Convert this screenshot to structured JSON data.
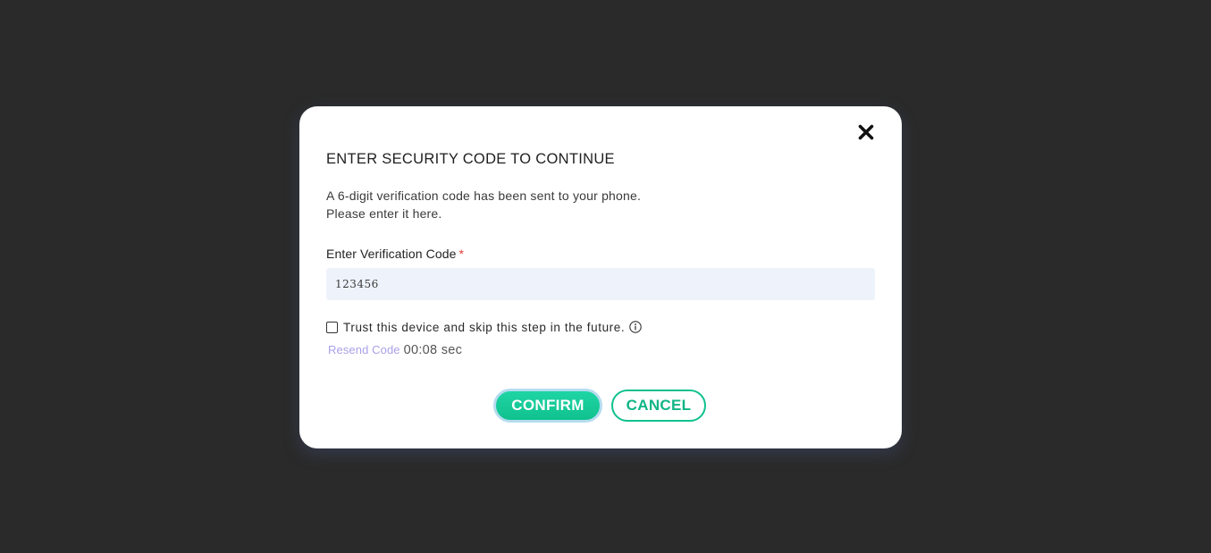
{
  "modal": {
    "title": "ENTER SECURITY CODE TO CONTINUE",
    "description_line1": "A 6-digit verification code has been sent to your phone.",
    "description_line2": "Please enter it here.",
    "close_icon": "close-icon"
  },
  "code_field": {
    "label": "Enter Verification Code",
    "required_mark": "*",
    "value": "123456"
  },
  "trust_device": {
    "label": "Trust this device and skip this step in the future.",
    "checked": false,
    "info_icon": "info-icon"
  },
  "resend": {
    "link_label": "Resend Code",
    "timer": "00:08 sec"
  },
  "actions": {
    "confirm_label": "CONFIRM",
    "cancel_label": "CANCEL"
  },
  "colors": {
    "backdrop": "#2a2a2a",
    "accent": "#10c18e",
    "link": "#a9a1e8",
    "required": "#e53935",
    "input_bg": "#eef3fb"
  }
}
